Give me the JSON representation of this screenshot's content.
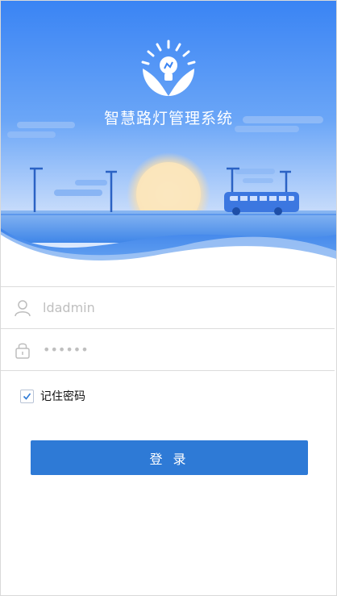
{
  "app": {
    "title": "智慧路灯管理系统"
  },
  "form": {
    "username": {
      "value": "",
      "placeholder": "ldadmin"
    },
    "password": {
      "value": "",
      "placeholder": "••••••"
    },
    "remember_label": "记住密码",
    "remember_checked": true,
    "login_label": "登 录"
  },
  "icons": {
    "logo": "lightbulb-hands-logo",
    "username": "user-icon",
    "password": "lock-icon",
    "checkbox": "check-icon"
  },
  "colors": {
    "primary": "#2e7ad6",
    "hero_top": "#3a86f5",
    "hero_bottom": "#dbe9ff"
  }
}
